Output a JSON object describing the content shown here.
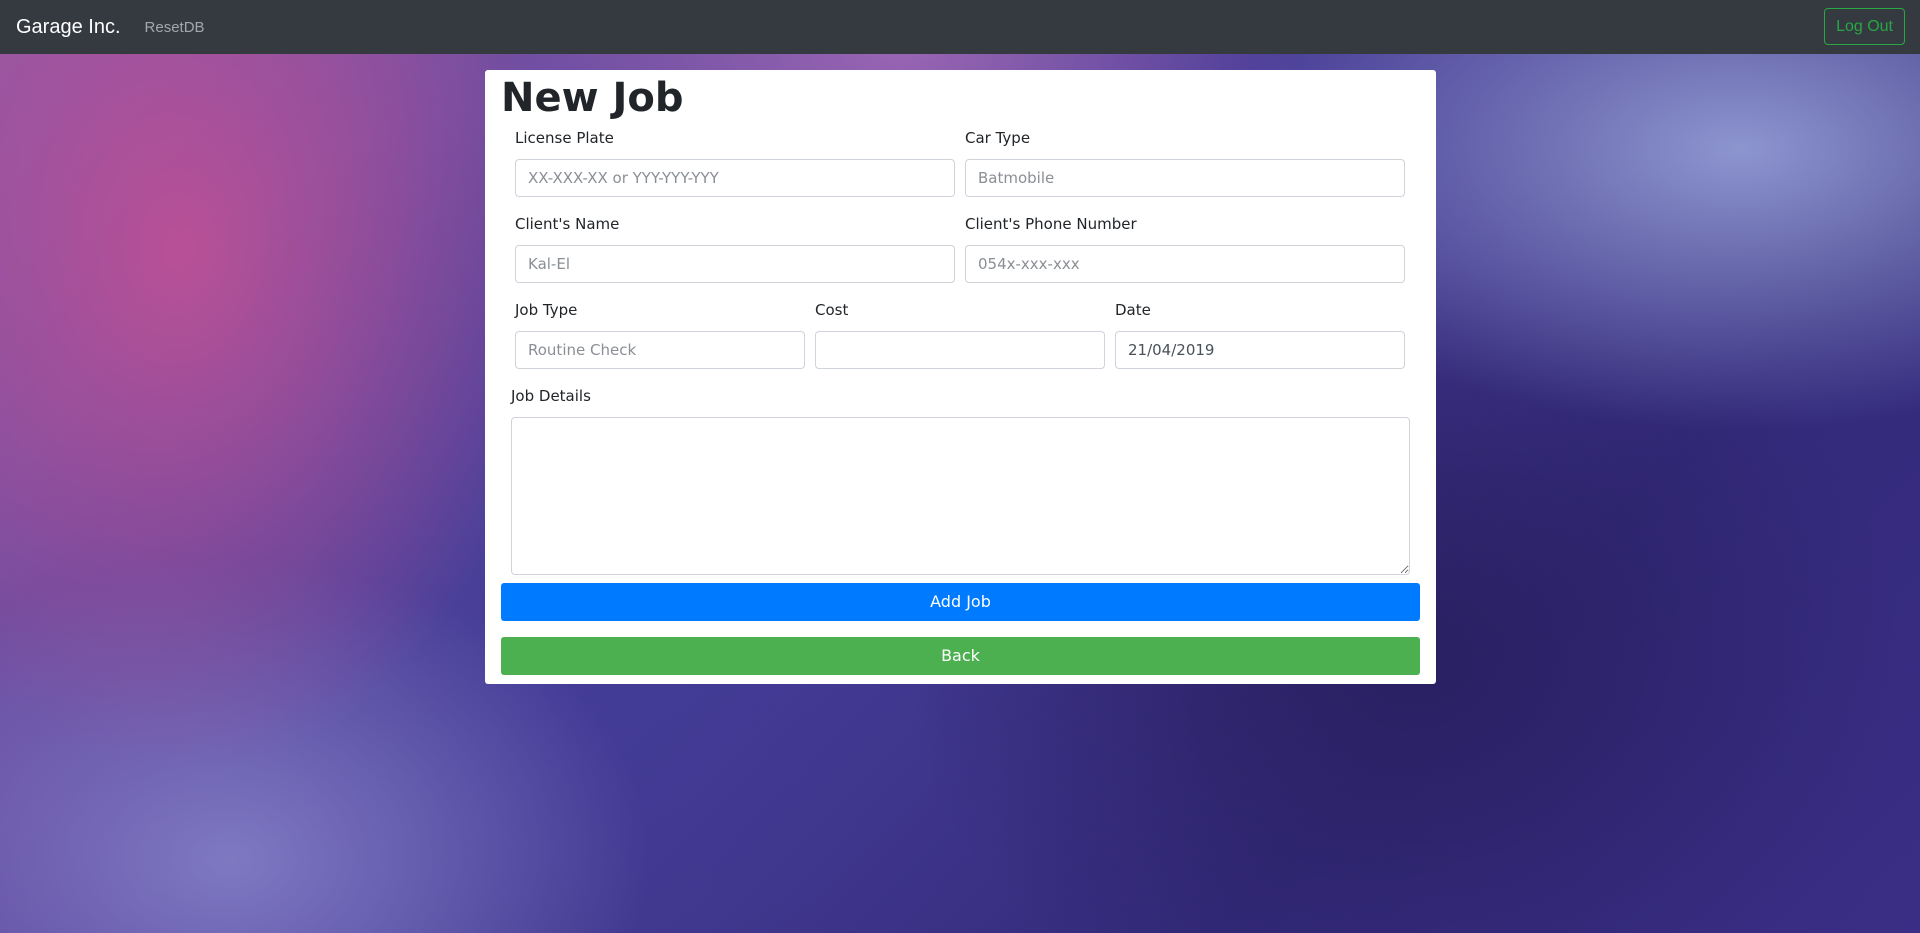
{
  "navbar": {
    "brand": "Garage Inc.",
    "reset_link": "ResetDB",
    "logout_label": "Log Out"
  },
  "form": {
    "title": "New Job",
    "license_plate": {
      "label": "License Plate",
      "placeholder": "XX-XXX-XX or YYY-YYY-YYY",
      "value": ""
    },
    "car_type": {
      "label": "Car Type",
      "placeholder": "Batmobile",
      "value": ""
    },
    "client_name": {
      "label": "Client's Name",
      "placeholder": "Kal-El",
      "value": ""
    },
    "client_phone": {
      "label": "Client's Phone Number",
      "placeholder": "054x-xxx-xxx",
      "value": ""
    },
    "job_type": {
      "label": "Job Type",
      "placeholder": "Routine Check",
      "value": ""
    },
    "cost": {
      "label": "Cost",
      "placeholder": "",
      "value": ""
    },
    "date": {
      "label": "Date",
      "placeholder": "",
      "value": "21/04/2019"
    },
    "job_details": {
      "label": "Job Details",
      "value": ""
    },
    "add_button": "Add Job",
    "back_button": "Back"
  },
  "colors": {
    "navbar_bg": "#343a40",
    "primary": "#007bff",
    "success": "#4caf50",
    "logout_outline": "#28a745"
  }
}
